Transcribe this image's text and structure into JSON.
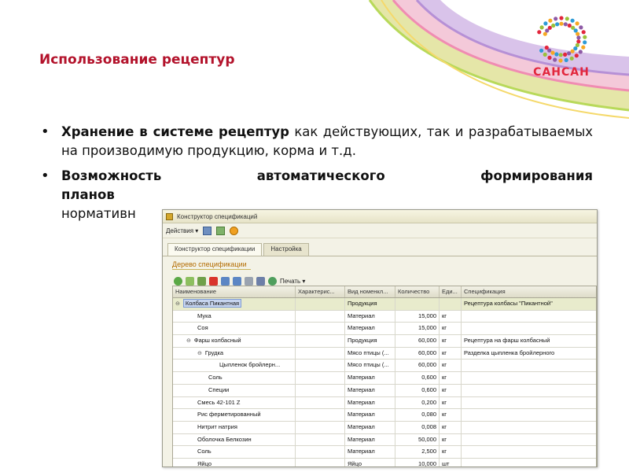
{
  "slide": {
    "title": "Использование рецептур",
    "bullets": [
      {
        "bold": "Хранение в системе рецептур",
        "rest": " как действующих, так и разрабатываемых на производимую продукцию, корма и т.д."
      },
      {
        "bold_line1": "Возможность автоматического формирования",
        "line2_bold": "планов",
        "line3": "нормативн"
      }
    ]
  },
  "logo": {
    "text": "САНСАН",
    "colors": [
      "#e2263c",
      "#f7a823",
      "#9ac13b",
      "#8e5aa6",
      "#2e9bd6"
    ]
  },
  "window": {
    "title": "Конструктор спецификаций",
    "toolbar": {
      "actions_label": "Действия ▾"
    },
    "tabs": [
      {
        "label": "Конструктор спецификации",
        "active": true
      },
      {
        "label": "Настройка",
        "active": false
      }
    ],
    "group_title": "Дерево спецификации",
    "grid_toolbar": {
      "print_label": "Печать ▾"
    },
    "columns": [
      "Наименование",
      "Характерис...",
      "Вид номенкл...",
      "Количество",
      "Еди...",
      "Спецификация"
    ],
    "rows": [
      {
        "indent": 0,
        "toggle": "⊖",
        "name": "Колбаса Пикантная",
        "kind": "Продукция",
        "qty": "",
        "unit": "",
        "spec": "Рецептура колбасы \"Пикантной\"",
        "selected": true
      },
      {
        "indent": 2,
        "toggle": "",
        "name": "Мука",
        "kind": "Материал",
        "qty": "15,000",
        "unit": "кг",
        "spec": ""
      },
      {
        "indent": 2,
        "toggle": "",
        "name": "Соя",
        "kind": "Материал",
        "qty": "15,000",
        "unit": "кг",
        "spec": ""
      },
      {
        "indent": 1,
        "toggle": "⊖",
        "name": "Фарш колбасный",
        "kind": "Продукция",
        "qty": "60,000",
        "unit": "кг",
        "spec": "Рецептура на фарш колбасный"
      },
      {
        "indent": 2,
        "toggle": "⊖",
        "name": "Грудка",
        "kind": "Мясо птицы (...",
        "qty": "60,000",
        "unit": "кг",
        "spec": "Разделка цыпленка бройлерного"
      },
      {
        "indent": 4,
        "toggle": "",
        "name": "Цыпленок бройлерн...",
        "kind": "Мясо птицы (...",
        "qty": "60,000",
        "unit": "кг",
        "spec": ""
      },
      {
        "indent": 3,
        "toggle": "",
        "name": "Соль",
        "kind": "Материал",
        "qty": "0,600",
        "unit": "кг",
        "spec": ""
      },
      {
        "indent": 3,
        "toggle": "",
        "name": "Специи",
        "kind": "Материал",
        "qty": "0,600",
        "unit": "кг",
        "spec": ""
      },
      {
        "indent": 2,
        "toggle": "",
        "name": "Смесь 42-101 Z",
        "kind": "Материал",
        "qty": "0,200",
        "unit": "кг",
        "spec": ""
      },
      {
        "indent": 2,
        "toggle": "",
        "name": "Рис ферметированный",
        "kind": "Материал",
        "qty": "0,080",
        "unit": "кг",
        "spec": ""
      },
      {
        "indent": 2,
        "toggle": "",
        "name": "Нитрит натрия",
        "kind": "Материал",
        "qty": "0,008",
        "unit": "кг",
        "spec": ""
      },
      {
        "indent": 2,
        "toggle": "",
        "name": "Оболочка Белкозин",
        "kind": "Материал",
        "qty": "50,000",
        "unit": "кг",
        "spec": ""
      },
      {
        "indent": 2,
        "toggle": "",
        "name": "Соль",
        "kind": "Материал",
        "qty": "2,500",
        "unit": "кг",
        "spec": ""
      },
      {
        "indent": 2,
        "toggle": "",
        "name": "Яйцо",
        "kind": "Яйцо",
        "qty": "10,000",
        "unit": "шт",
        "spec": ""
      }
    ]
  }
}
